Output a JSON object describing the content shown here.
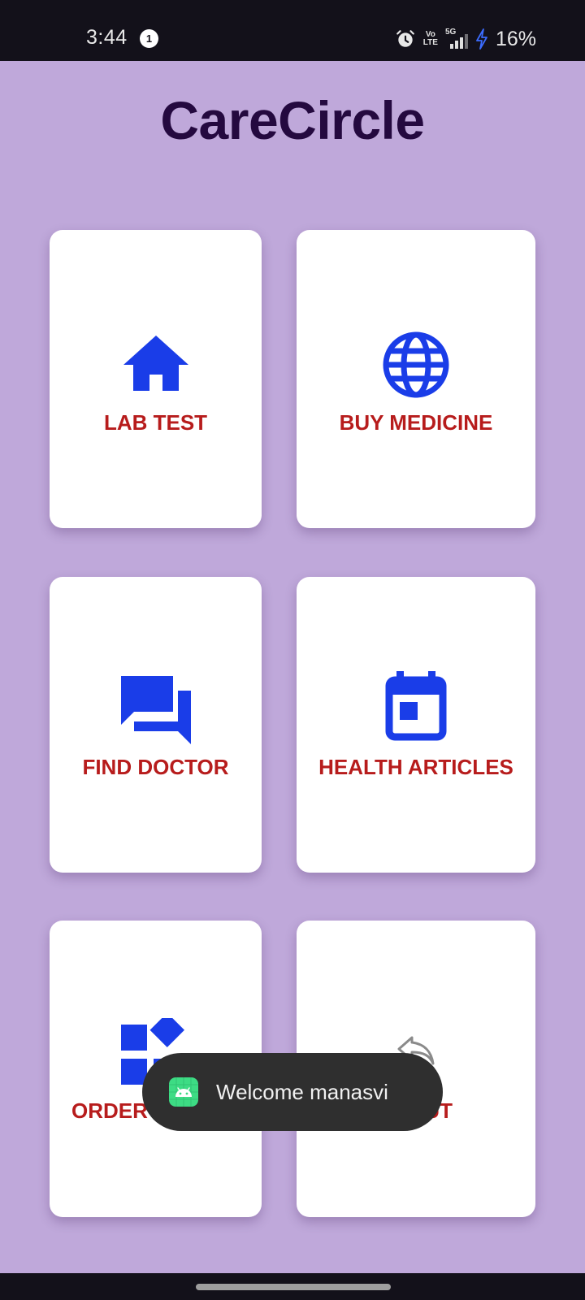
{
  "status_bar": {
    "time": "3:44",
    "notification_count": "1",
    "volte_line1": "Vo",
    "volte_line2": "LTE",
    "network": "5G",
    "battery": "16%",
    "icons": [
      "alarm-icon",
      "volte-icon",
      "signal-icon",
      "charging-icon"
    ]
  },
  "app": {
    "title": "CareCircle"
  },
  "cards": [
    {
      "label": "LAB TEST",
      "icon": "home-icon"
    },
    {
      "label": "BUY MEDICINE",
      "icon": "globe-icon"
    },
    {
      "label": "FIND DOCTOR",
      "icon": "chat-bubbles-icon"
    },
    {
      "label": "HEALTH ARTICLES",
      "icon": "calendar-icon"
    },
    {
      "label": "ORDER",
      "icon": "widgets-icon"
    },
    {
      "label": "UT",
      "icon": "logout-icon"
    }
  ],
  "toast": {
    "message": "Welcome manasvi",
    "icon": "android-app-icon"
  },
  "colors": {
    "background": "#bfa8da",
    "title": "#24093f",
    "icon_blue": "#1a3de8",
    "label_red": "#b71c1c",
    "card": "#ffffff",
    "toast": "#2f2f2f",
    "status_bar": "#13111a"
  }
}
